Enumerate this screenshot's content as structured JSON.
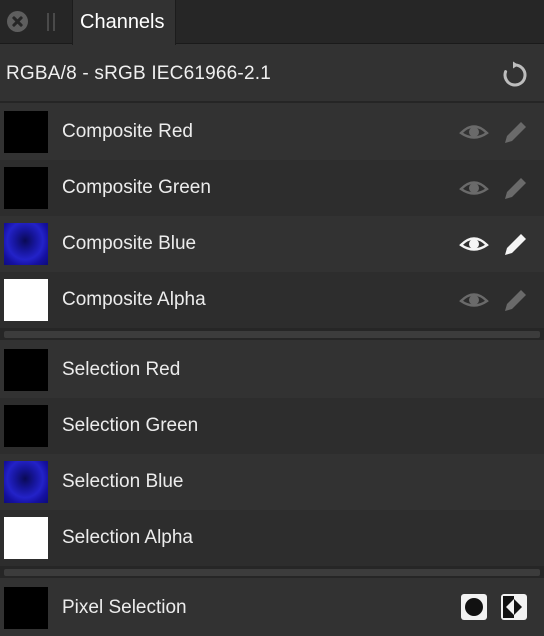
{
  "panel": {
    "tab_label": "Channels",
    "format": "RGBA/8 - sRGB IEC61966-2.1"
  },
  "composite_channels": [
    {
      "label": "Composite Red",
      "thumbnail": "black",
      "visible": false,
      "editable": false
    },
    {
      "label": "Composite Green",
      "thumbnail": "black",
      "visible": false,
      "editable": false
    },
    {
      "label": "Composite Blue",
      "thumbnail": "blue-image",
      "visible": true,
      "editable": true
    },
    {
      "label": "Composite Alpha",
      "thumbnail": "white",
      "visible": false,
      "editable": false
    }
  ],
  "selection_channels": [
    {
      "label": "Selection Red",
      "thumbnail": "black"
    },
    {
      "label": "Selection Green",
      "thumbnail": "black"
    },
    {
      "label": "Selection Blue",
      "thumbnail": "blue-image"
    },
    {
      "label": "Selection Alpha",
      "thumbnail": "white"
    }
  ],
  "pixel_selection": {
    "label": "Pixel Selection",
    "thumbnail": "black"
  },
  "icons": {
    "close": "close-icon",
    "grip": "grip-icon",
    "reset": "reset-icon",
    "visibility": "eye-icon",
    "edit": "pencil-icon",
    "fill": "circle-fill-icon",
    "invert": "invert-icon"
  },
  "colors": {
    "panel_bg": "#323232",
    "row_alt_bg": "#2d2d2d",
    "tab_bar_bg": "#262626",
    "text": "#ececec",
    "icon_active": "#f5f5f5",
    "icon_inactive": "#6a6a6a"
  }
}
